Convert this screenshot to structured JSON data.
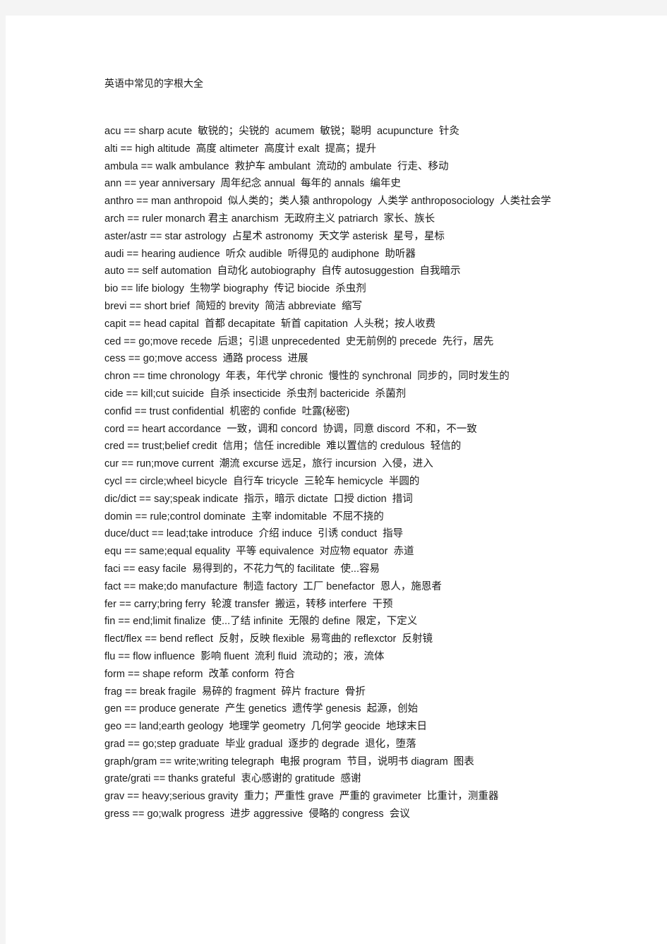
{
  "document": {
    "title": "英语中常见的字根大全",
    "lines": [
      "acu == sharp acute  敏锐的；尖锐的  acumem  敏锐；聪明  acupuncture  针灸",
      "alti == high altitude  高度 altimeter  高度计 exalt  提高；提升",
      "ambula == walk ambulance  救护车 ambulant  流动的 ambulate  行走、移动",
      "ann == year anniversary  周年纪念 annual  每年的 annals  编年史",
      "anthro == man anthropoid  似人类的；类人猿 anthropology  人类学 anthroposociology  人类社会学",
      "arch == ruler monarch 君主 anarchism  无政府主义 patriarch  家长、族长",
      "aster/astr == star astrology  占星术 astronomy  天文学 asterisk  星号，星标",
      "audi == hearing audience  听众 audible  听得见的 audiphone  助听器",
      "auto == self automation  自动化 autobiography  自传 autosuggestion  自我暗示",
      "bio == life biology  生物学 biography  传记 biocide  杀虫剂",
      "brevi == short brief  简短的 brevity  简洁 abbreviate  缩写",
      "capit == head capital  首都 decapitate  斩首 capitation  人头税；按人收费",
      "ced == go;move recede  后退；引退 unprecedented  史无前例的 precede  先行，居先",
      "cess == go;move access  通路 process  进展",
      "chron == time chronology  年表，年代学 chronic  慢性的 synchronal  同步的，同时发生的",
      "cide == kill;cut suicide  自杀 insecticide  杀虫剂 bactericide  杀菌剂",
      "confid == trust confidential  机密的 confide  吐露(秘密)",
      "cord == heart accordance  一致，调和 concord  协调，同意 discord  不和，不一致",
      "cred == trust;belief credit  信用；信任 incredible  难以置信的 credulous  轻信的",
      "cur == run;move current  潮流 excurse 远足，旅行 incursion  入侵，进入",
      "cycl == circle;wheel bicycle  自行车 tricycle  三轮车 hemicycle  半圆的",
      "dic/dict == say;speak indicate  指示，暗示 dictate  口授 diction  措词",
      "domin == rule;control dominate  主宰 indomitable  不屈不挠的",
      "duce/duct == lead;take introduce  介绍 induce  引诱 conduct  指导",
      "equ == same;equal equality  平等 equivalence  对应物 equator  赤道",
      "faci == easy facile  易得到的，不花力气的 facilitate  使...容易",
      "fact == make;do manufacture  制造 factory  工厂 benefactor  恩人，施恩者",
      "fer == carry;bring ferry  轮渡 transfer  搬运，转移 interfere  干预",
      "fin == end;limit finalize  使...了结 infinite  无限的 define  限定，下定义",
      "flect/flex == bend reflect  反射，反映 flexible  易弯曲的 reflexctor  反射镜",
      "flu == flow influence  影响 fluent  流利 fluid  流动的；液，流体",
      "form == shape reform  改革 conform  符合",
      "frag == break fragile  易碎的 fragment  碎片 fracture  骨折",
      "gen == produce generate  产生 genetics  遗传学 genesis  起源，创始",
      "geo == land;earth geology  地理学 geometry  几何学 geocide  地球末日",
      "grad == go;step graduate  毕业 gradual  逐步的 degrade  退化，堕落",
      "graph/gram == write;writing telegraph  电报 program  节目，说明书 diagram  图表",
      "grate/grati == thanks grateful  衷心感谢的 gratitude  感谢",
      "grav == heavy;serious gravity  重力；严重性 grave  严重的 gravimeter  比重计，测重器",
      "gress == go;walk progress  进步 aggressive  侵略的 congress  会议"
    ]
  },
  "colors": {
    "page_background": "#ffffff",
    "canvas_background": "#f4f4f4",
    "text": "#1a1a1a"
  }
}
